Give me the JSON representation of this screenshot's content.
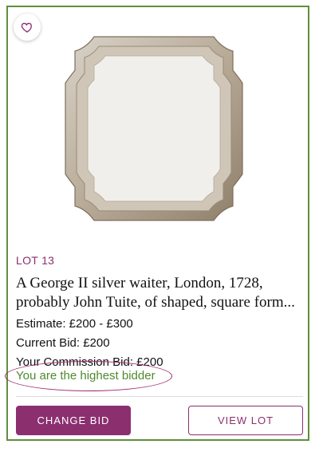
{
  "lot": {
    "number_label": "LOT 13",
    "title": "A George II silver waiter, London, 1728, probably John Tuite, of shaped, square form...",
    "estimate": "Estimate: £200 - £300",
    "current_bid": "Current Bid: £200",
    "commission_bid": "Your Commission Bid: £200",
    "status": "You are the highest bidder"
  },
  "actions": {
    "change_bid": "CHANGE BID",
    "view_lot": "VIEW LOT"
  },
  "icons": {
    "favorite": "heart-outline-icon"
  },
  "colors": {
    "accent": "#8b2f6f",
    "status_green": "#4f8a2e",
    "card_border": "#5f8f3c"
  }
}
